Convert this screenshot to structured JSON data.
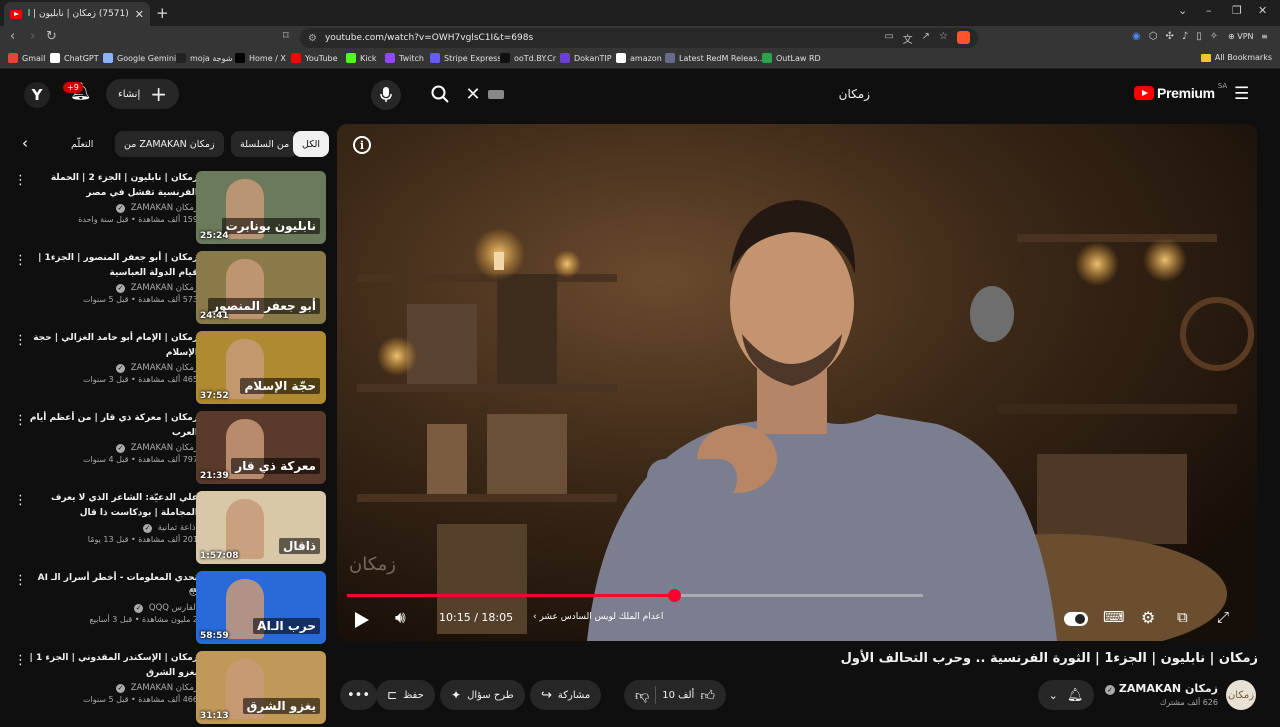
{
  "browser": {
    "tab_title": "(7571) زمكان | نابليون | الجزء1 | ا",
    "url": "youtube.com/watch?v=OWH7vglsC1I&t=698s",
    "vpn_label": "VPN",
    "bookmarks": [
      {
        "label": "Gmail",
        "color": "#ea4335"
      },
      {
        "label": "ChatGPT",
        "color": "#ffffff"
      },
      {
        "label": "Google Gemini",
        "color": "#8ab4f8"
      },
      {
        "label": "moja شوجة",
        "color": "#222222"
      },
      {
        "label": "Home / X",
        "color": "#000000"
      },
      {
        "label": "YouTube",
        "color": "#ff0000"
      },
      {
        "label": "Kick",
        "color": "#53fc18"
      },
      {
        "label": "Twitch",
        "color": "#9146ff"
      },
      {
        "label": "Stripe Express",
        "color": "#635bff"
      },
      {
        "label": "ooTd.BY.Cr",
        "color": "#111111"
      },
      {
        "label": "DokanTIP",
        "color": "#6b3fd1"
      },
      {
        "label": "amazon",
        "color": "#ffffff"
      },
      {
        "label": "Latest RedM Releas...",
        "color": "#6a6a8a"
      },
      {
        "label": "OutLaw RD",
        "color": "#2aa34a"
      }
    ],
    "all_bookmarks": "All Bookmarks"
  },
  "header": {
    "avatar_letter": "Y",
    "notif_badge": "+9",
    "create_label": "إنشاء",
    "search_value": "زمكان",
    "logo_text": "Premium",
    "region": "SA"
  },
  "chips": [
    "الكل",
    "من السلسلة",
    "من ZAMAKAN زمكان",
    "التعلّم"
  ],
  "recommendations": [
    {
      "title": "زمكان | نابليون | الجزء 2 | الحملة الفرنسية تفشل في مصر",
      "channel": "زمكان ZAMAKAN",
      "meta": "159 ألف مشاهدة • قبل سنة واحدة",
      "duration": "25:24",
      "thumb_text": "نابليون بونابرت",
      "thumb_color": "#6b7a5a"
    },
    {
      "title": "زمكان | أبو جعفر المنصور | الجزء1 | قيام الدولة العباسية",
      "channel": "زمكان ZAMAKAN",
      "meta": "573 ألف مشاهدة • قبل 5 سنوات",
      "duration": "24:41",
      "thumb_text": "أبو جعفر المنصور",
      "thumb_color": "#8a7a4a"
    },
    {
      "title": "زمكان | الإمام أبو حامد الغزالي | حجة الإسلام",
      "channel": "زمكان ZAMAKAN",
      "meta": "465 ألف مشاهدة • قبل 3 سنوات",
      "duration": "37:52",
      "thumb_text": "حجّة الإسلام",
      "thumb_color": "#b08a30"
    },
    {
      "title": "زمكان | معركة ذي قار | من أعظم أيام العرب",
      "channel": "زمكان ZAMAKAN",
      "meta": "797 ألف مشاهدة • قبل 4 سنوات",
      "duration": "21:39",
      "thumb_text": "معركة ذي قار",
      "thumb_color": "#5a3a2a"
    },
    {
      "title": "علي الدعيّة: الشاعر الذي لا يعرف المجاملة | بودكاست ذا قال",
      "channel": "إذاعة ثمانية",
      "meta": "201 ألف مشاهدة • قبل 13 يومًا",
      "duration": "1:57:08",
      "thumb_text": "ذاقال",
      "thumb_color": "#d8c8a8"
    },
    {
      "title": "تحدي المعلومات - أخطر أسرار الـ AI 😳",
      "channel": "الفارس QQQ",
      "meta": "2 مليون مشاهدة • قبل 3 أسابيع",
      "duration": "58:59",
      "thumb_text": "حرب الـAI",
      "thumb_color": "#2a6ad8"
    },
    {
      "title": "زمكان | الإسكندر المقدوني | الجزء 1 | يغزو الشرق",
      "channel": "زمكان ZAMAKAN",
      "meta": "466 ألف مشاهدة • قبل 5 سنوات",
      "duration": "31:13",
      "thumb_text": "يغزو الشرق",
      "thumb_color": "#c09858"
    }
  ],
  "player": {
    "current_time": "10:15",
    "duration": "18:05",
    "time_display": "10:15 / 18:05",
    "chapter": "اعدام الملك لويس السادس عشر",
    "progress_fraction": 0.567,
    "settings_badge": "HD",
    "watermark": "زمكان"
  },
  "video": {
    "title": "زمكان | نابليون | الجزء1 | الثورة الفرنسية .. وحرب التحالف الأول",
    "channel": "زمكان ZAMAKAN",
    "subscribers": "626 ألف مشترك",
    "likes": "10 ألف",
    "share_label": "مشاركة",
    "ask_label": "طرح سؤال",
    "save_label": "حفظ"
  }
}
